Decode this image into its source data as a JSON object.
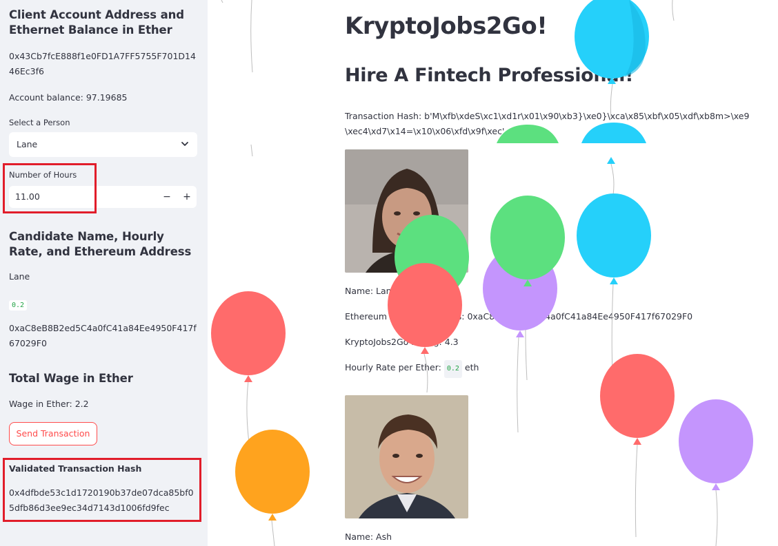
{
  "sidebar": {
    "account_header": "Client Account Address and Ethernet Balance in Ether",
    "client_address": "0x43Cb7fcE888f1e0FD1A7FF5755F701D1446Ec3f6",
    "account_balance": "Account balance: 97.19685",
    "select_person_label": "Select a Person",
    "selected_person": "Lane",
    "hours_label": "Number of Hours",
    "hours_value": "11.00",
    "minus_label": "−",
    "plus_label": "+",
    "candidate_header": "Candidate Name, Hourly Rate, and Ethereum Address",
    "candidate_name": "Lane",
    "candidate_rate": "0.2",
    "candidate_address": "0xaC8eB8B2ed5C4a0fC41a84Ee4950F417f67029F0",
    "wage_header": "Total Wage in Ether",
    "wage_text": "Wage in Ether: 2.2",
    "send_button": "Send Transaction",
    "validated_header": "Validated Transaction Hash",
    "validated_hash": "0x4dfbde53c1d1720190b37de07dca85bf05dfb86d3ee9ec34d7143d1006fd9fec"
  },
  "main": {
    "title": "KryptoJobs2Go!",
    "subtitle": "Hire A Fintech Professional!",
    "tx_hash": "Transaction Hash: b'M\\xfb\\xdeS\\xc1\\xd1r\\x01\\x90\\xb3}\\xe0}\\xca\\x85\\xbf\\x05\\xdf\\xb8m>\\xe9\\xec4\\xd7\\x14=\\x10\\x06\\xfd\\x9f\\xec'",
    "candidates": [
      {
        "name": "Name: Lane",
        "eth_address": "Ethereum Account Address: 0xaC8eB8B2ed5C4a0fC41a84Ee4950F417f67029F0",
        "rating": "KryptoJobs2Go Rating: 4.3",
        "rate_prefix": "Hourly Rate per Ether:",
        "rate_value": "0.2",
        "rate_suffix": "eth"
      },
      {
        "name": "Name: Ash"
      }
    ]
  },
  "colors": {
    "accent": "#ff4b4b",
    "highlight": "#e11d2a",
    "balloon_red": "#ff6b6b",
    "balloon_green": "#5ce07f",
    "balloon_blue": "#25d0fa",
    "balloon_purple": "#c495fd",
    "balloon_orange": "#ffa31e"
  }
}
